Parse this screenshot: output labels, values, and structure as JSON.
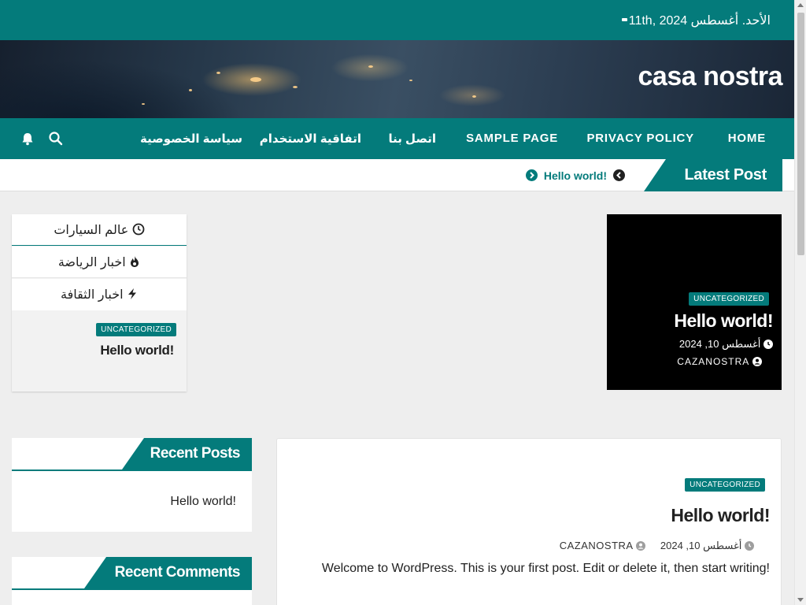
{
  "topbar": {
    "date": "الأحد. أغسطس 11th, 2024"
  },
  "header": {
    "site_title": "casa nostra"
  },
  "nav": {
    "items": [
      "HOME",
      "PRIVACY POLICY",
      "SAMPLE PAGE",
      "اتصل بنا",
      "اتفاقية الاستخدام",
      "سياسة الخصوصية"
    ],
    "icons": [
      "search-icon",
      "bell-icon"
    ]
  },
  "ticker": {
    "label": "Latest Post",
    "item": "Hello world!"
  },
  "featured": {
    "category": "UNCATEGORIZED",
    "title": "Hello world!",
    "date": "أغسطس 10, 2024",
    "author": "CAZANOSTRA"
  },
  "tabs": {
    "items": [
      {
        "label": "عالم السيارات",
        "icon": "clock-icon"
      },
      {
        "label": "اخبار الرياضة",
        "icon": "fire-icon"
      },
      {
        "label": "اخبار الثقافة",
        "icon": "bolt-icon"
      }
    ],
    "post_category": "UNCATEGORIZED",
    "post_title": "Hello world!"
  },
  "widgets": {
    "recent_posts": {
      "title": "Recent Posts",
      "entry": "Hello world!"
    },
    "recent_comments": {
      "title": "Recent Comments"
    }
  },
  "post": {
    "category": "UNCATEGORIZED",
    "title": "Hello world!",
    "date": "أغسطس 10, 2024",
    "author": "CAZANOSTRA",
    "excerpt": "Welcome to WordPress. This is your first post. Edit or delete it, then start writing!"
  },
  "colors": {
    "accent": "#047b7b",
    "background": "#eeeeee"
  }
}
